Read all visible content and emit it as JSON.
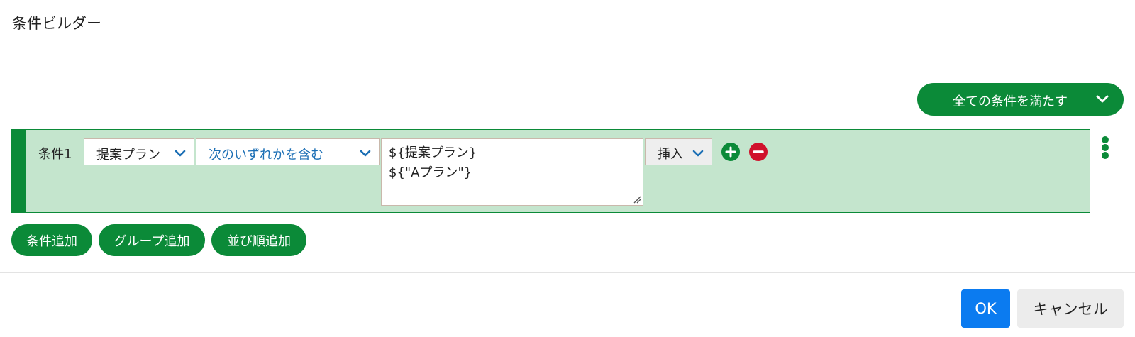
{
  "dialog": {
    "title": "条件ビルダー"
  },
  "match_mode": {
    "selected": "全ての条件を満たす",
    "icon": "chevron-down-icon"
  },
  "conditions": [
    {
      "name": "条件1",
      "field": "提案プラン",
      "operator": "次のいずれかを含む",
      "value_lines": [
        "${提案プラン}",
        "${\"Aプラン\"}"
      ],
      "insert_label": "挿入"
    }
  ],
  "actions": {
    "add_condition": "条件追加",
    "add_group": "グループ追加",
    "add_sort": "並び順追加"
  },
  "footer": {
    "ok": "OK",
    "cancel": "キャンセル"
  },
  "colors": {
    "primary_green": "#0b8a38",
    "row_background": "#c4e5cd",
    "remove_red": "#d0112b",
    "ok_blue": "#0b7bf0",
    "operator_text": "#1c6fb5"
  }
}
